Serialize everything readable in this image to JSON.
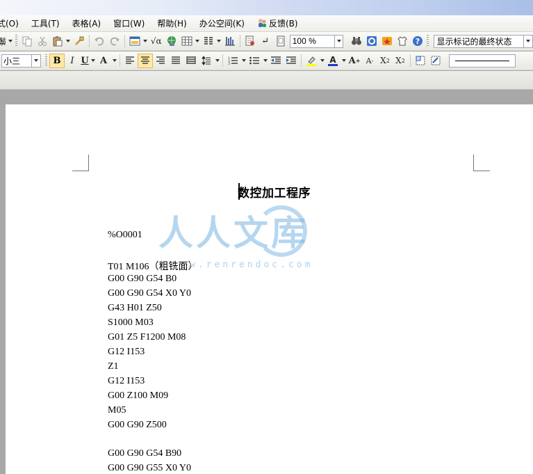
{
  "menubar": {
    "items": [
      "式(O)",
      "工具(T)",
      "表格(A)",
      "窗口(W)",
      "帮助(H)",
      "办公空间(K)",
      "反馈(B)"
    ]
  },
  "toolbar1": {
    "left_text": "鬃",
    "zoom": "100 %",
    "markup_view": "显示标记的最终状态"
  },
  "toolbar2": {
    "font_size": "小三"
  },
  "document": {
    "title": "数控加工程序",
    "lines": [
      "%O0001",
      "",
      "T01 M106（粗铣面）",
      "G00 G90 G54 B0",
      "G00 G90 G54 X0 Y0",
      "G43 H01 Z50",
      "S1000 M03",
      "G01 Z5 F1200 M08",
      "G12 I153",
      "Z1",
      "G12 I153",
      "G00 Z100 M09",
      "M05",
      "G00 G90 Z500",
      "",
      "G00 G90 G54 B90",
      "G00 G90 G55 X0 Y0"
    ]
  },
  "watermark": {
    "text": "人人文库",
    "url": "w.renrendoc.com"
  },
  "colors": {
    "watermark": "#78b4e1",
    "active_button": "#fde8a8"
  }
}
